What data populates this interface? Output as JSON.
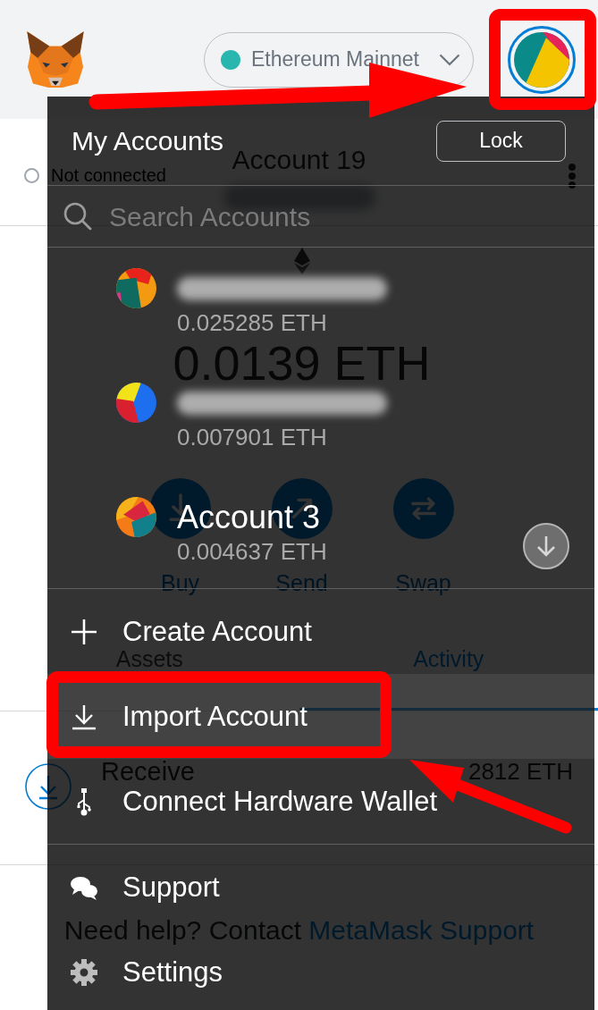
{
  "header": {
    "network": "Ethereum Mainnet",
    "account_button": {
      "annotated": true
    }
  },
  "account": {
    "connection": "Not connected",
    "name": "Account 19",
    "address_redacted": true
  },
  "balance": "0.0139 ETH",
  "actions": [
    {
      "label": "Buy",
      "kind": "buy"
    },
    {
      "label": "Send",
      "kind": "send"
    },
    {
      "label": "Swap",
      "kind": "swap"
    }
  ],
  "tabs": [
    {
      "label": "Assets",
      "selected": false
    },
    {
      "label": "Activity",
      "selected": true
    }
  ],
  "activity": [
    {
      "title": "Receive",
      "amount": "2812 ETH"
    }
  ],
  "help": {
    "text": "Need help? Contact",
    "link": "MetaMask Support"
  },
  "menu": {
    "title": "My Accounts",
    "lock_button": "Lock",
    "search": {
      "placeholder": "Search Accounts"
    },
    "accounts": [
      {
        "redacted": true,
        "balance": "0.025285 ETH"
      },
      {
        "redacted": true,
        "balance": "0.007901 ETH"
      },
      {
        "name": "Account 3",
        "redacted": false,
        "balance": "0.004637 ETH"
      }
    ],
    "actions": [
      {
        "label": "Create Account",
        "kind": "create",
        "hovered": false,
        "annotated": false
      },
      {
        "label": "Import Account",
        "kind": "import",
        "hovered": true,
        "annotated": true
      },
      {
        "label": "Connect Hardware Wallet",
        "kind": "hardware",
        "hovered": false,
        "annotated": false
      }
    ],
    "links": [
      {
        "label": "Support",
        "kind": "support",
        "hovered": false,
        "annotated": false
      },
      {
        "label": "Settings",
        "kind": "settings",
        "hovered": false,
        "annotated": false
      }
    ]
  }
}
